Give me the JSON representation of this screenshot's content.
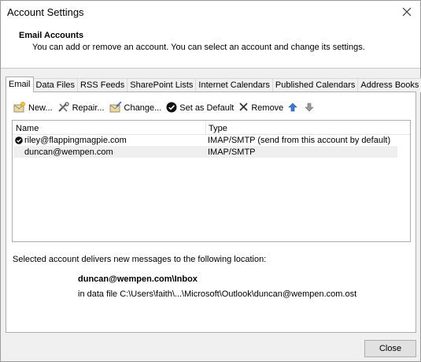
{
  "window": {
    "title": "Account Settings"
  },
  "header": {
    "title": "Email Accounts",
    "description": "You can add or remove an account. You can select an account and change its settings."
  },
  "tabs": [
    {
      "label": "Email",
      "active": true
    },
    {
      "label": "Data Files",
      "active": false
    },
    {
      "label": "RSS Feeds",
      "active": false
    },
    {
      "label": "SharePoint Lists",
      "active": false
    },
    {
      "label": "Internet Calendars",
      "active": false
    },
    {
      "label": "Published Calendars",
      "active": false
    },
    {
      "label": "Address Books",
      "active": false
    }
  ],
  "toolbar": {
    "new_label": "New...",
    "repair_label": "Repair...",
    "change_label": "Change...",
    "set_default_label": "Set as Default",
    "remove_label": "Remove"
  },
  "accounts_list": {
    "columns": {
      "name": "Name",
      "type": "Type"
    },
    "rows": [
      {
        "name": "riley@flappingmagpie.com",
        "type": "IMAP/SMTP (send from this account by default)",
        "is_default": true
      },
      {
        "name": "duncan@wempen.com",
        "type": "IMAP/SMTP",
        "is_default": false,
        "selected": true
      }
    ]
  },
  "delivery": {
    "intro": "Selected account delivers new messages to the following location:",
    "folder": "duncan@wempen.com\\Inbox",
    "data_file": "in data file C:\\Users\\faith\\...\\Microsoft\\Outlook\\duncan@wempen.com.ost"
  },
  "footer": {
    "close_label": "Close"
  }
}
